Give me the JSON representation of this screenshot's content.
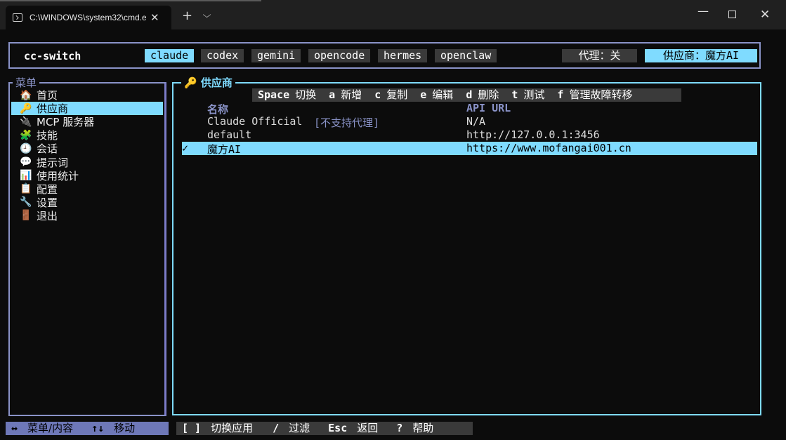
{
  "window": {
    "tab_title": "C:\\WINDOWS\\system32\\cmd.e",
    "close_glyph": "✕",
    "new_tab_glyph": "+",
    "dropdown_glyph": "⌵",
    "minimize_glyph": "—",
    "close_window_glyph": "✕"
  },
  "header": {
    "app_name": "cc-switch",
    "apps": [
      "claude",
      "codex",
      "gemini",
      "opencode",
      "hermes",
      "openclaw"
    ],
    "active_app": "claude",
    "proxy_status": "代理：关",
    "provider_status": "供应商：魔方AI"
  },
  "menu": {
    "title": "菜单",
    "items": [
      {
        "icon": "🏠",
        "icon_name": "home-icon",
        "label": "首页"
      },
      {
        "icon": "🔑",
        "icon_name": "key-icon",
        "label": "供应商"
      },
      {
        "icon": "🔌",
        "icon_name": "plug-icon",
        "label": "MCP 服务器"
      },
      {
        "icon": "🧩",
        "icon_name": "puzzle-icon",
        "label": "技能"
      },
      {
        "icon": "🕘",
        "icon_name": "clock-icon",
        "label": "会话"
      },
      {
        "icon": "💬",
        "icon_name": "speech-bubble-icon",
        "label": "提示词"
      },
      {
        "icon": "📊",
        "icon_name": "bar-chart-icon",
        "label": "使用统计"
      },
      {
        "icon": "📋",
        "icon_name": "clipboard-icon",
        "label": "配置"
      },
      {
        "icon": "🔧",
        "icon_name": "wrench-icon",
        "label": "设置"
      },
      {
        "icon": "🚪",
        "icon_name": "door-icon",
        "label": "退出"
      }
    ],
    "active_index": 1
  },
  "providers": {
    "title_icon": "🔑",
    "title": "供应商",
    "hotkeys": [
      {
        "key": "Space",
        "label": "切换"
      },
      {
        "key": "a",
        "label": "新增"
      },
      {
        "key": "c",
        "label": "复制"
      },
      {
        "key": "e",
        "label": "编辑"
      },
      {
        "key": "d",
        "label": "删除"
      },
      {
        "key": "t",
        "label": "测试"
      },
      {
        "key": "f",
        "label": "管理故障转移"
      }
    ],
    "columns": {
      "name": "名称",
      "url": "API URL"
    },
    "rows": [
      {
        "check": "",
        "name": "Claude Official",
        "tag": "[不支持代理]",
        "url": "N/A"
      },
      {
        "check": "",
        "name": "default",
        "tag": "",
        "url": "http://127.0.0.1:3456"
      },
      {
        "check": "✓",
        "name": "魔方AI",
        "tag": "",
        "url": "https://www.mofangai001.cn"
      }
    ],
    "selected_index": 2
  },
  "footer": {
    "left": [
      {
        "key": "↔",
        "label": "菜单/内容"
      },
      {
        "key": "↑↓",
        "label": "移动"
      }
    ],
    "right": [
      {
        "key": "[ ]",
        "label": "切换应用"
      },
      {
        "key": "/",
        "label": "过滤"
      },
      {
        "key": "Esc",
        "label": "返回"
      },
      {
        "key": "?",
        "label": "帮助"
      }
    ]
  },
  "colors": {
    "highlight": "#7fdbff",
    "border": "#8a93c8",
    "background": "#0c0c0c"
  }
}
